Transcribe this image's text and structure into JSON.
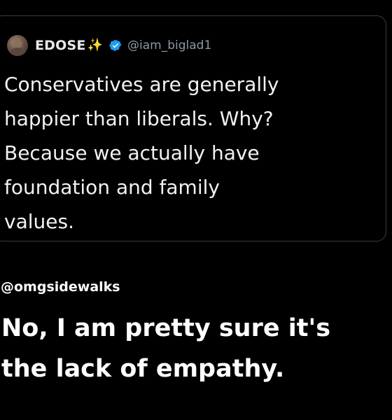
{
  "quoted_tweet": {
    "author": {
      "display_name": "EDOSE",
      "name_emoji": "✨",
      "handle": "@iam_biglad1",
      "verified": true
    },
    "text": "Conservatives are generally\nhappier than liberals. Why?\nBecause we actually have\nfoundation and family\nvalues."
  },
  "reply": {
    "handle": "@omgsidewalks",
    "text": "No, I am pretty sure it's\nthe lack of empathy."
  },
  "colors": {
    "background": "#000000",
    "card_border": "#3a3d40",
    "handle_gray": "#8b98a5",
    "verified_blue": "#1d9bf0",
    "sparkle_gold": "#f6c544"
  },
  "icons": {
    "verified": "verified-badge-icon",
    "sparkle": "sparkles-icon"
  }
}
